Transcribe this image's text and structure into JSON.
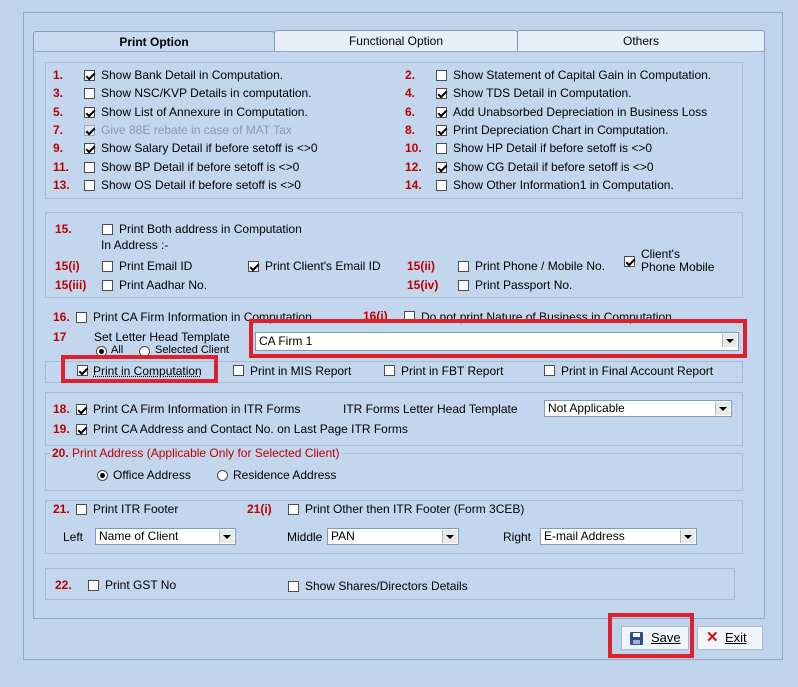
{
  "tabs": [
    {
      "label": "Print Option"
    },
    {
      "label": "Functional Option"
    },
    {
      "label": "Others"
    }
  ],
  "options_left": [
    {
      "num": "1.",
      "label": "Show Bank Detail in Computation.",
      "checked": true
    },
    {
      "num": "3.",
      "label": "Show NSC/KVP Details in computation.",
      "checked": false
    },
    {
      "num": "5.",
      "label": "Show List of Annexure in Computation.",
      "checked": true
    },
    {
      "num": "7.",
      "label": "Give 88E rebate in case of MAT Tax",
      "checked": true,
      "disabled": true
    },
    {
      "num": "9.",
      "label": "Show Salary Detail if before setoff is <>0",
      "checked": true
    },
    {
      "num": "11.",
      "label": "Show BP Detail if before setoff is <>0",
      "checked": false
    },
    {
      "num": "13.",
      "label": "Show OS Detail if before setoff is <>0",
      "checked": false
    }
  ],
  "options_right": [
    {
      "num": "2.",
      "label": "Show Statement of Capital Gain in Computation.",
      "checked": false
    },
    {
      "num": "4.",
      "label": "Show TDS Detail in Computation.",
      "checked": true
    },
    {
      "num": "6.",
      "label": "Add Unabsorbed Depreciation in Business Loss",
      "checked": true
    },
    {
      "num": "8.",
      "label": "Print Depreciation Chart in Computation.",
      "checked": true
    },
    {
      "num": "10.",
      "label": "Show HP Detail if before setoff is <>0",
      "checked": false
    },
    {
      "num": "12.",
      "label": "Show CG Detail if before setoff is <>0",
      "checked": true
    },
    {
      "num": "14.",
      "label": "Show Other Information1 in Computation.",
      "checked": false
    }
  ],
  "s15": {
    "num": "15.",
    "both_label": "Print Both address in Computation",
    "in_address": "In Address :-",
    "i_num": "15(i)",
    "email": "Print Email ID",
    "client_email": "Print Client's Email ID",
    "ii_num": "15(ii)",
    "phone": "Print Phone / Mobile No.",
    "client_phone": "Client's\nPhone Mobile",
    "iii_num": "15(iii)",
    "aadhar": "Print Aadhar No.",
    "iv_num": "15(iv)",
    "passport": "Print Passport No."
  },
  "s16": {
    "num": "16.",
    "label": "Print CA Firm Information in Computation",
    "i_num": "16(i)",
    "i_label": "Do not print Nature of Business in Computation"
  },
  "s17": {
    "num": "17",
    "label": "Set Letter Head Template",
    "radio_all": "All",
    "radio_selected": "Selected Client",
    "template_value": "CA Firm 1"
  },
  "print_row": {
    "computation": "Print in Computation",
    "mis": "Print in MIS Report",
    "fbt": "Print in FBT Report",
    "final": "Print in Final Account Report"
  },
  "s18": {
    "num": "18.",
    "label": "Print CA Firm Information in ITR Forms",
    "template_label": "ITR Forms Letter Head Template",
    "template_value": "Not Applicable"
  },
  "s19": {
    "num": "19.",
    "label": "Print CA Address and Contact No. on Last Page ITR Forms"
  },
  "s20": {
    "legend_num": "20.",
    "legend": "Print Address (Applicable Only for Selected Client)",
    "office": "Office Address",
    "residence": "Residence Address"
  },
  "s21": {
    "num": "21.",
    "label": "Print ITR Footer",
    "i_num": "21(i)",
    "i_label": "Print Other then ITR Footer (Form 3CEB)",
    "left_label": "Left",
    "left_value": "Name of Client",
    "middle_label": "Middle",
    "middle_value": "PAN",
    "right_label": "Right",
    "right_value": "E-mail Address"
  },
  "s22": {
    "num": "22.",
    "label": "Print GST No",
    "shares": "Show Shares/Directors Details"
  },
  "buttons": {
    "save": "Save",
    "exit": "Exit"
  },
  "colors": {
    "accent_red": "#e0202a",
    "number_red": "#c00000",
    "background": "#bfd3eb"
  }
}
